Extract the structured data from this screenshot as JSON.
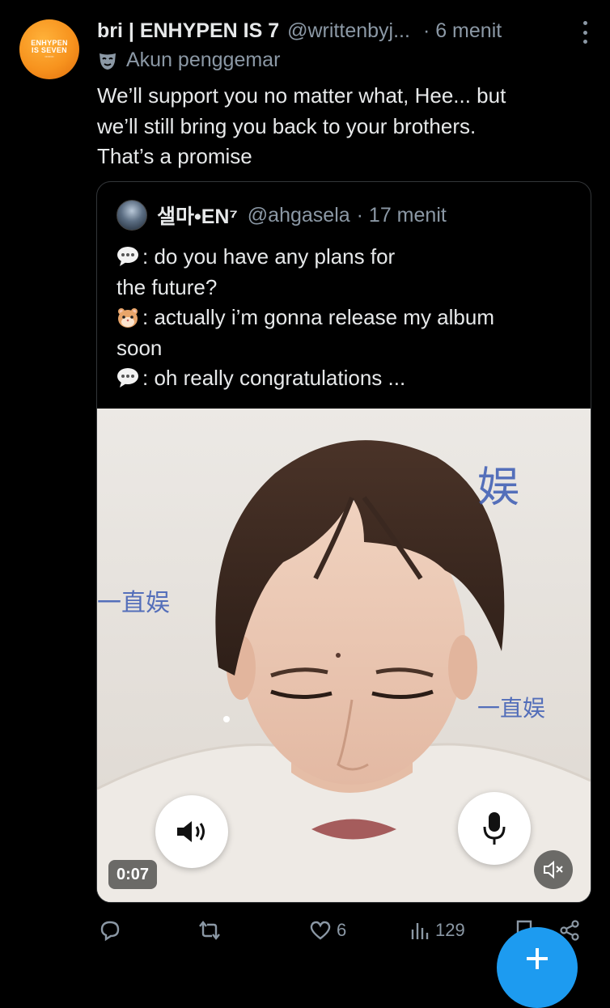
{
  "tweet": {
    "avatar_text": [
      "ENHYPEN",
      "IS SEVEN"
    ],
    "display_name": "bri | ENHYPEN IS 7",
    "handle": "@writtenbyj...",
    "time": "· 6 menit",
    "account_label": "Akun penggemar",
    "text_lines": [
      "We’ll support you no matter what, Hee... but",
      "we’ll still bring you back to your brothers.",
      "That’s a promise"
    ]
  },
  "quote": {
    "display_name": "샐마•EN⁷",
    "handle": "@ahgasela",
    "time": "· 17 menit",
    "lines": [
      {
        "emoji": "speech-bubble",
        "text": ": do you have any plans for"
      },
      {
        "emoji": "",
        "text": "the future?"
      },
      {
        "emoji": "hamster",
        "text": ": actually i’m gonna release my album"
      },
      {
        "emoji": "",
        "text": "soon"
      },
      {
        "emoji": "speech-bubble",
        "text": ": oh really congratulations ..."
      }
    ],
    "video": {
      "duration": "0:07",
      "overlay_chars": [
        "娱",
        "一直娱",
        "一直娱"
      ]
    }
  },
  "actions": {
    "reply_count": "",
    "retweet_count": "",
    "like_count": "6",
    "views_count": "129"
  },
  "colors": {
    "background": "#000000",
    "text_primary": "#e7e9ea",
    "text_secondary": "#8b98a5",
    "accent": "#1d9bf0",
    "avatar_orange": "#f7931e"
  }
}
